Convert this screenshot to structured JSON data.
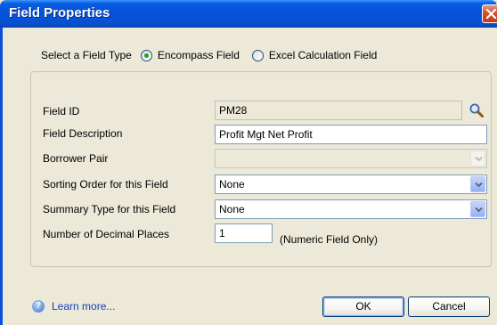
{
  "window": {
    "title": "Field Properties",
    "close_icon": "close-icon"
  },
  "field_type": {
    "label": "Select a Field Type",
    "options": [
      {
        "label": "Encompass Field",
        "checked": true
      },
      {
        "label": "Excel Calculation Field",
        "checked": false
      }
    ]
  },
  "form": {
    "field_id_label": "Field ID",
    "field_id_value": "PM28",
    "field_description_label": "Field Description",
    "field_description_value": "Profit Mgt Net Profit",
    "borrower_pair_label": "Borrower Pair",
    "borrower_pair_value": "",
    "sorting_order_label": "Sorting Order for this Field",
    "sorting_order_value": "None",
    "summary_type_label": "Summary Type for this Field",
    "summary_type_value": "None",
    "decimal_places_label": "Number of Decimal Places",
    "decimal_places_value": "1",
    "decimal_places_hint": "(Numeric Field Only)"
  },
  "footer": {
    "learn_more": "Learn more...",
    "ok_label": "OK",
    "cancel_label": "Cancel"
  },
  "colors": {
    "titlebar": "#0453d9",
    "dialog_bg": "#ece9d8",
    "link": "#1c3fb8",
    "radio_checked": "#21a121"
  }
}
